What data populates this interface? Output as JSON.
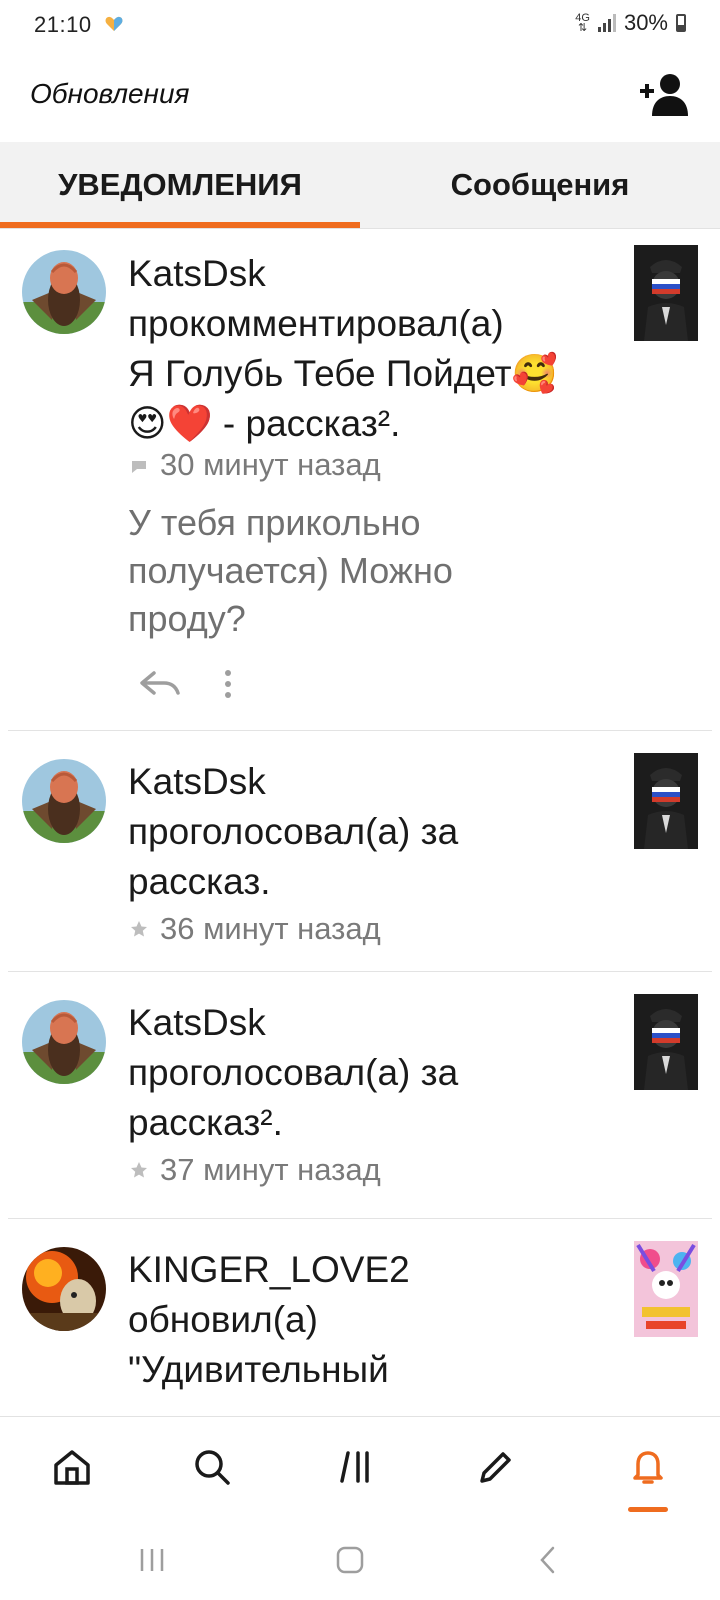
{
  "status_bar": {
    "time": "21:10",
    "network": "4G",
    "battery": "30%"
  },
  "header": {
    "title": "Обновления"
  },
  "tabs": [
    {
      "label": "УВЕДОМЛЕНИЯ",
      "active": true
    },
    {
      "label": "Сообщения",
      "active": false
    }
  ],
  "notifications": [
    {
      "line1": "KatsDsk",
      "line2": "прокомментировал(а)",
      "line3": "Я Голубь Тебе Пойдет🥰",
      "line4": "😍❤️ - рассказ².",
      "time": "30 минут назад",
      "time_icon": "comment-icon",
      "comment": [
        "У тебя прикольно",
        "получается) Можно",
        "проду?"
      ]
    },
    {
      "line1": "KatsDsk",
      "line2": "проголосовал(а) за",
      "line3": "рассказ.",
      "time": "36 минут назад",
      "time_icon": "star-icon"
    },
    {
      "line1": "KatsDsk",
      "line2": "проголосовал(а) за",
      "line3": "рассказ².",
      "time": "37 минут назад",
      "time_icon": "star-icon"
    },
    {
      "line1": "KINGER_LOVE2",
      "line2": "обновил(а)",
      "line3": "\"Удивительный"
    }
  ],
  "bottom_nav": [
    {
      "icon": "home-icon"
    },
    {
      "icon": "search-icon"
    },
    {
      "icon": "library-icon"
    },
    {
      "icon": "write-icon"
    },
    {
      "icon": "bell-icon",
      "active": true
    }
  ],
  "colors": {
    "accent": "#ef6c1f",
    "muted": "#7a7a7a"
  }
}
